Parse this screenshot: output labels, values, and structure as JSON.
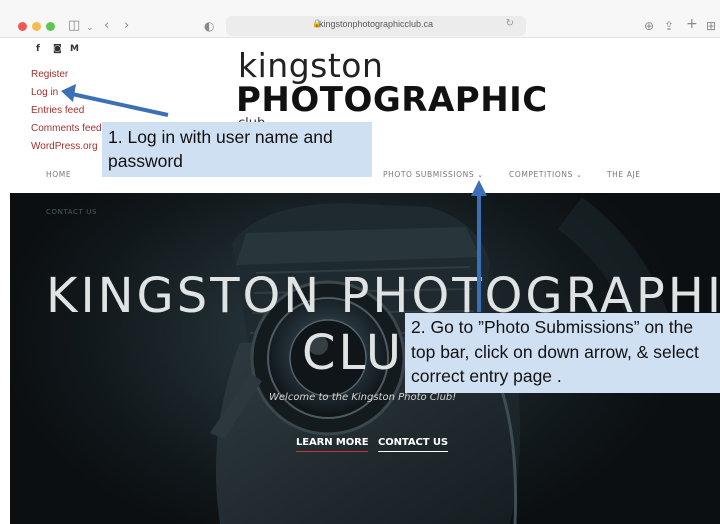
{
  "browser": {
    "url": "kingstonphotographicclub.ca",
    "icons": [
      "sidebar-icon",
      "chevron-down-icon",
      "back-icon",
      "forward-icon",
      "shield-icon",
      "lock-icon",
      "reload-icon",
      "download-icon",
      "share-icon",
      "new-tab-icon",
      "grid-icon"
    ]
  },
  "site": {
    "social": {
      "facebook": "f",
      "instagram": "◙",
      "email": "M"
    },
    "meta_links": [
      "Register",
      "Log in",
      "Entries feed",
      "Comments feed",
      "WordPress.org"
    ],
    "logo": {
      "top": "kingston",
      "bottom": "PHOTOGRAPHIC",
      "tail": "club"
    },
    "nav": {
      "home": "HOME",
      "photo_submissions": "PHOTO SUBMISSIONS",
      "competitions": "COMPETITIONS",
      "the_aje": "THE AJE",
      "contact_us": "CONTACT US"
    }
  },
  "hero": {
    "title_line1": "KINGSTON PHOTOGRAPHIC",
    "title_line2": "CLUB",
    "welcome": "Welcome to the Kingston Photo Club!",
    "learn_more": "LEARN MORE",
    "contact_us": "CONTACT US"
  },
  "annotations": {
    "step1": "1. Log in with user name and password",
    "step2": "2. Go to ”Photo Submissions” on the top bar, click on down arrow, & select  correct entry page ."
  },
  "colors": {
    "link": "#a0322e",
    "callout": "#cfe0f3",
    "arrow": "#3b6fb6",
    "hero_bg": "#141c20"
  }
}
